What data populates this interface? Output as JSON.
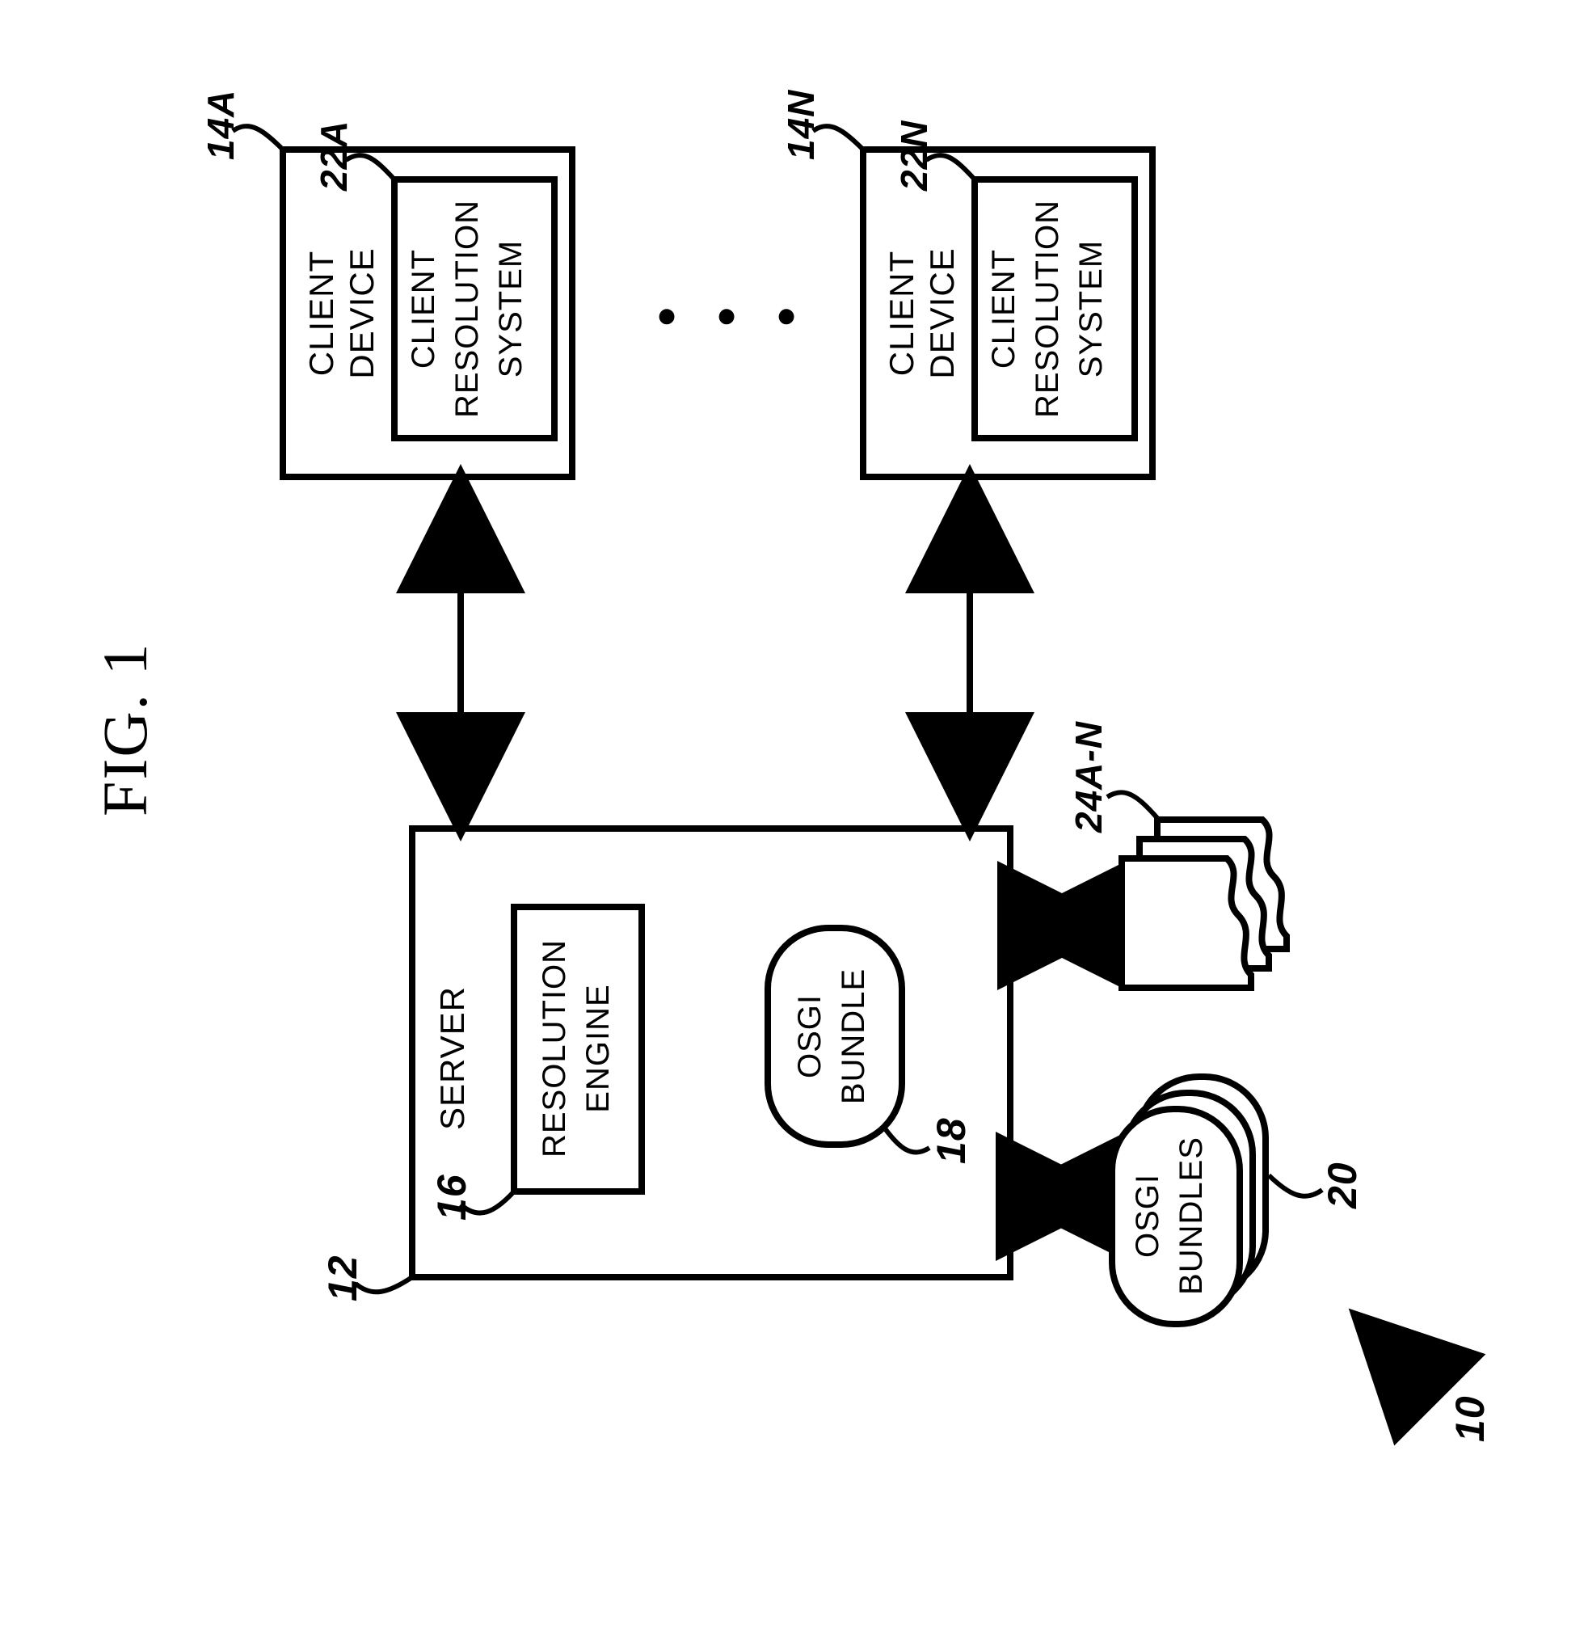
{
  "figure_title": "FIG. 1",
  "refs": {
    "overall": "10",
    "server": "12",
    "client_top": "14A",
    "client_bottom": "14N",
    "resolution_engine": "16",
    "osgi_bundle": "18",
    "osgi_bundles": "20",
    "client_res_top": "22A",
    "client_res_bottom": "22N",
    "docs": "24A-N"
  },
  "labels": {
    "server": "SERVER",
    "resolution_line1": "RESOLUTION",
    "resolution_line2": "ENGINE",
    "osgi_line1": "OSGI",
    "osgi_line2": "BUNDLE",
    "client_device": "CLIENT",
    "client_device2": "DEVICE",
    "client_res1": "CLIENT",
    "client_res2": "RESOLUTION",
    "client_res3": "SYSTEM",
    "osgi_bundles1": "OSGI",
    "osgi_bundles2": "BUNDLES",
    "ellipsis1": "•",
    "ellipsis2": "•",
    "ellipsis3": "•"
  }
}
